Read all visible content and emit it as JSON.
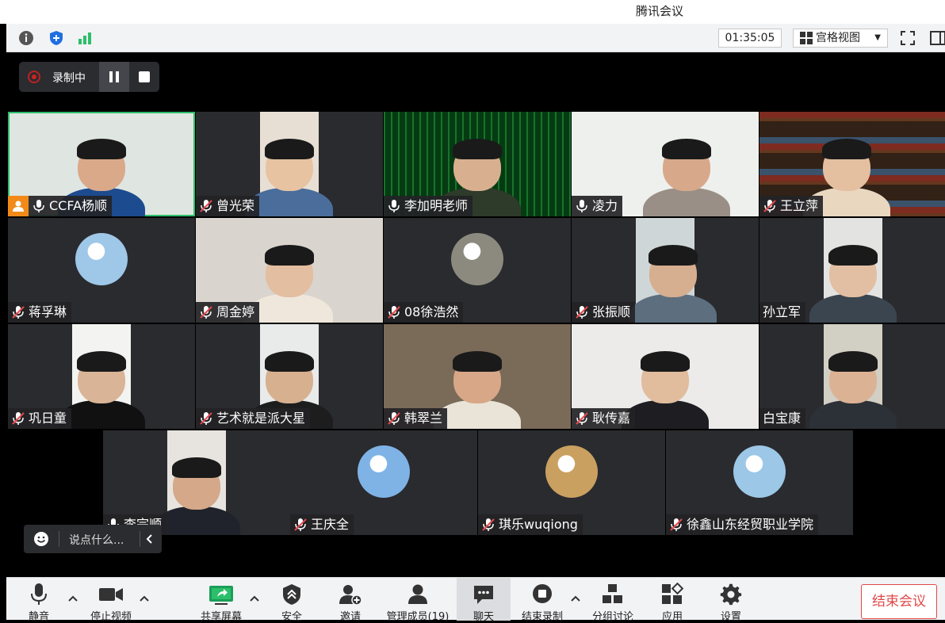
{
  "window": {
    "title": "腾讯会议"
  },
  "top_toolbar": {
    "timer": "01:35:05",
    "view_mode": "宫格视图",
    "icons": [
      "info-icon",
      "security-shield-icon",
      "signal-icon",
      "fullscreen-icon",
      "sidebar-icon"
    ]
  },
  "recording": {
    "status": "录制中"
  },
  "tiles": [
    {
      "name": "CCFA杨顺",
      "mic": "on",
      "host": true,
      "active": true,
      "kind": "video"
    },
    {
      "name": "曾光荣",
      "mic": "muted",
      "kind": "video"
    },
    {
      "name": "李加明老师",
      "mic": "on",
      "kind": "video"
    },
    {
      "name": "凌力",
      "mic": "on",
      "kind": "video"
    },
    {
      "name": "王立萍",
      "mic": "muted",
      "kind": "video"
    },
    {
      "name": "蒋孚琳",
      "mic": "muted",
      "kind": "avatar"
    },
    {
      "name": "周金婷",
      "mic": "muted",
      "kind": "video"
    },
    {
      "name": "08徐浩然",
      "mic": "muted",
      "kind": "avatar"
    },
    {
      "name": "张振顺",
      "mic": "muted",
      "kind": "video"
    },
    {
      "name": "孙立军",
      "mic": "none",
      "kind": "video"
    },
    {
      "name": "巩日童",
      "mic": "muted",
      "kind": "video"
    },
    {
      "name": "艺术就是派大星",
      "mic": "muted",
      "kind": "video"
    },
    {
      "name": "韩翠兰",
      "mic": "muted",
      "kind": "video"
    },
    {
      "name": "耿传嘉",
      "mic": "muted",
      "kind": "video"
    },
    {
      "name": "白宝康",
      "mic": "none",
      "kind": "video"
    },
    {
      "name": "李宗顺",
      "mic": "on",
      "kind": "video"
    },
    {
      "name": "王庆全",
      "mic": "muted",
      "kind": "avatar"
    },
    {
      "name": "琪乐wuqiong",
      "mic": "muted",
      "kind": "avatar"
    },
    {
      "name": "徐鑫山东经贸职业学院",
      "mic": "muted",
      "kind": "avatar"
    }
  ],
  "chat_input": {
    "placeholder": "说点什么..."
  },
  "bottom_bar": {
    "mute": "静音",
    "stop_video": "停止视频",
    "share_screen": "共享屏幕",
    "security": "安全",
    "invite": "邀请",
    "manage_members": "管理成员(19)",
    "chat": "聊天",
    "end_recording": "结束录制",
    "breakout": "分组讨论",
    "apps": "应用",
    "settings": "设置",
    "end_meeting": "结束会议"
  },
  "colors": {
    "accent_green": "#2cbf6a",
    "end_red": "#e04848",
    "host_orange": "#f28a1a",
    "record_red": "#cc2222"
  }
}
